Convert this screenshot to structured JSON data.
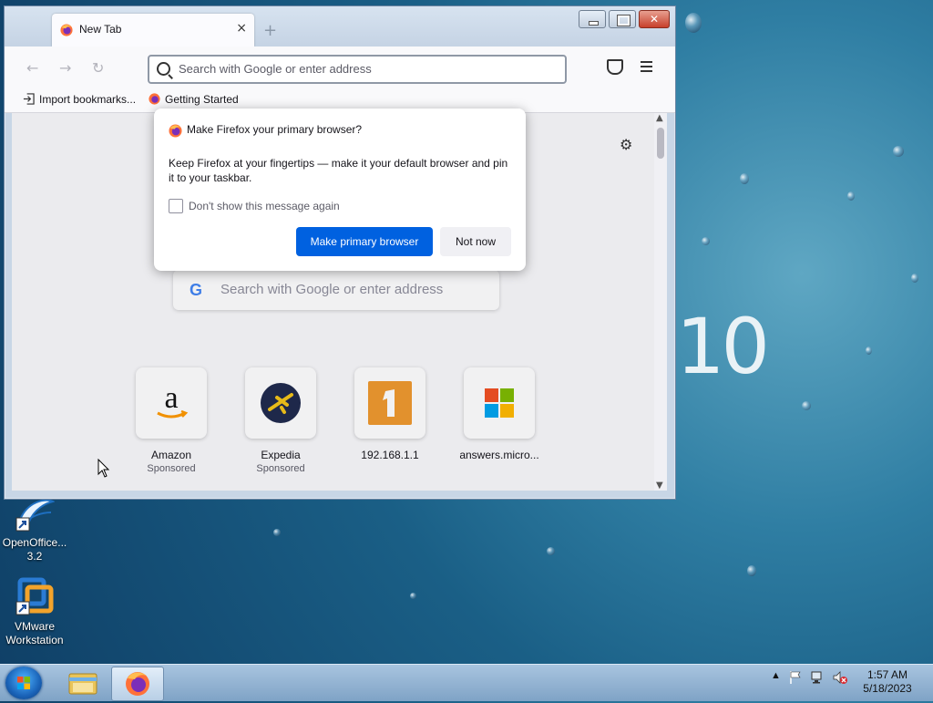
{
  "browser": {
    "tab": {
      "title": "New Tab",
      "close": "×"
    },
    "new_tab": "+",
    "window_controls": {
      "close": "✕"
    },
    "nav": {
      "back": "←",
      "forward": "→",
      "reload": "↻"
    },
    "urlbar": {
      "placeholder": "Search with Google or enter address"
    },
    "bookmarks": [
      {
        "label": "Import bookmarks...",
        "icon": "import-icon"
      },
      {
        "label": "Getting Started",
        "icon": "firefox-icon"
      }
    ]
  },
  "newtab": {
    "settings_icon": "⚙",
    "search": {
      "logo": "G",
      "placeholder": "Search with Google or enter address"
    },
    "top_sites": [
      {
        "name": "Amazon",
        "sponsor": "Sponsored",
        "icon": "amazon-icon"
      },
      {
        "name": "Expedia",
        "sponsor": "Sponsored",
        "icon": "expedia-icon"
      },
      {
        "name": "192.168.1.1",
        "sponsor": "",
        "icon": "site-1-icon"
      },
      {
        "name": "answers.micro...",
        "sponsor": "",
        "icon": "microsoft-icon"
      }
    ]
  },
  "dialog": {
    "title": "Make Firefox your primary browser?",
    "body": "Keep Firefox at your fingertips — make it your default browser and pin it to your taskbar.",
    "checkbox_label": "Don't show this message again",
    "checkbox_checked": false,
    "primary_button": "Make primary browser",
    "secondary_button": "Not now"
  },
  "desktop": {
    "wallpaper_text": "10",
    "icons": [
      {
        "label": "OpenOffice... 3.2",
        "icon": "openoffice-icon"
      },
      {
        "label": "VMware Workstation",
        "icon": "vmware-icon"
      }
    ]
  },
  "taskbar": {
    "clock_time": "1:57 AM",
    "clock_date": "5/18/2023",
    "tray_arrow": "▲"
  },
  "colors": {
    "accent_primary": "#0061e0",
    "firefox_orange": "#ff7139",
    "amazon_orange": "#ff9900",
    "expedia_navy": "#1f2a4d",
    "expedia_yellow": "#f5c518"
  }
}
